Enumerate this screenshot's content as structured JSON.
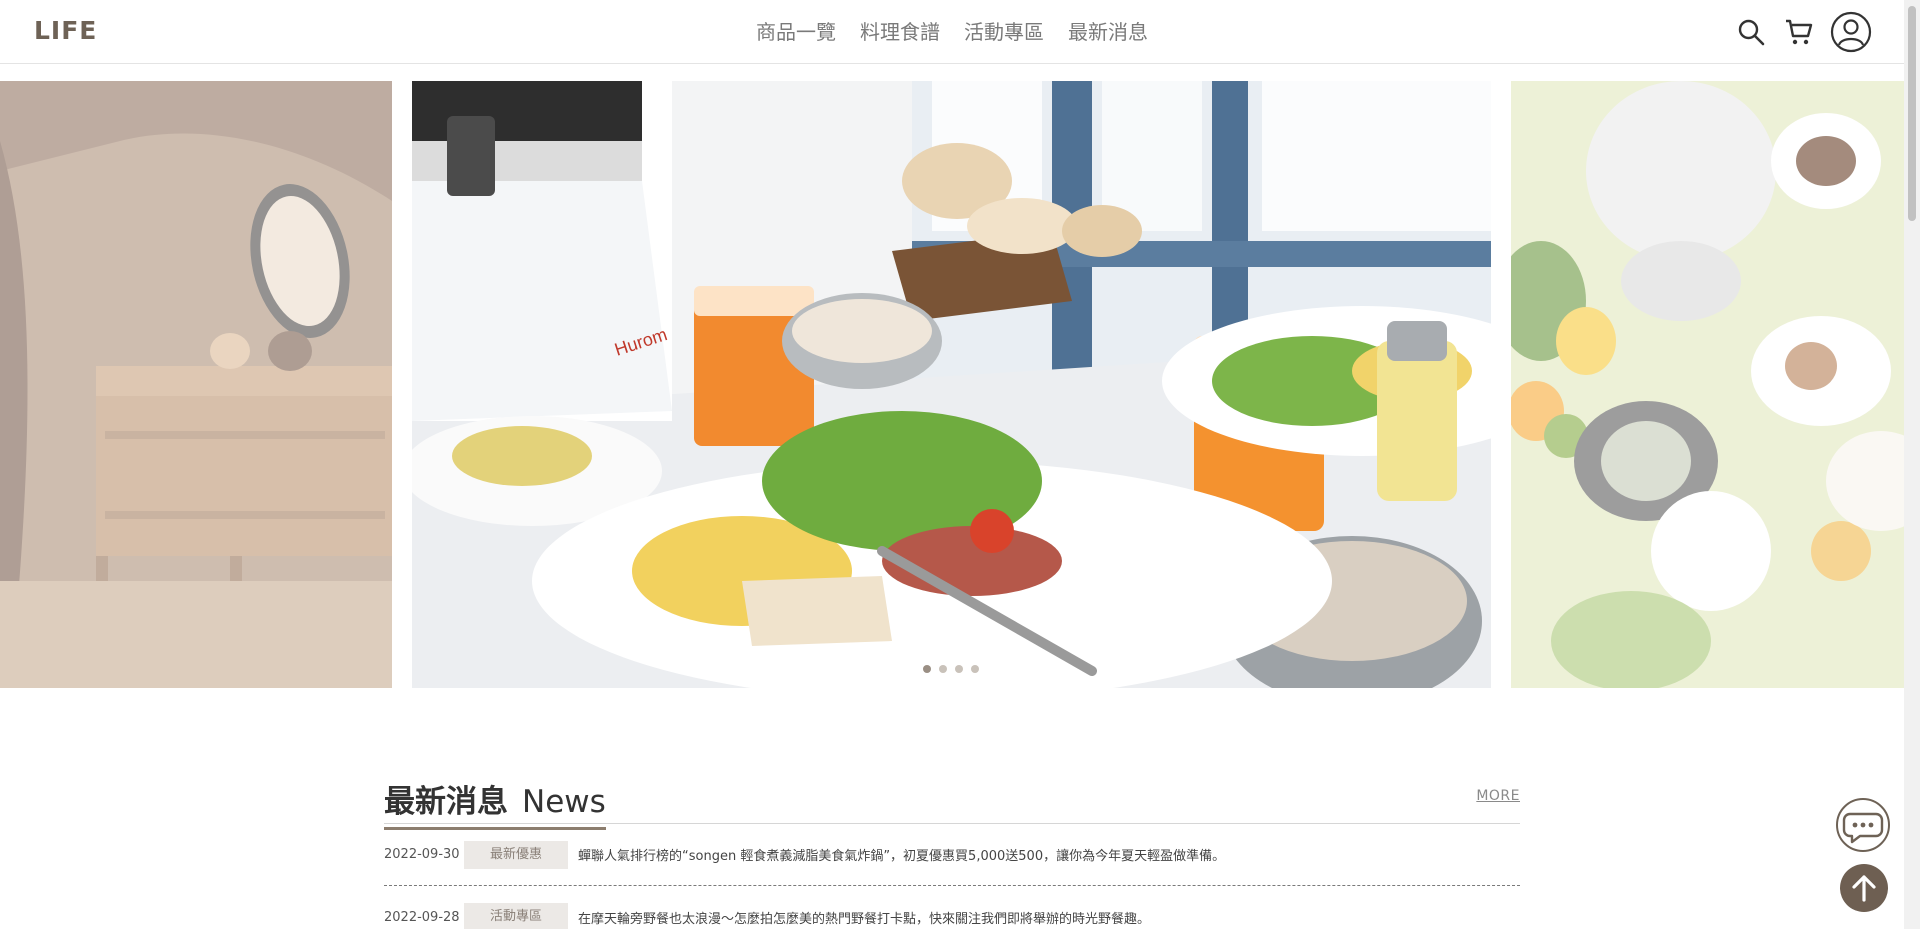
{
  "brand": {
    "logo": "LIFE"
  },
  "nav": {
    "items": [
      {
        "label": "商品一覽"
      },
      {
        "label": "料理食譜"
      },
      {
        "label": "活動專區"
      },
      {
        "label": "最新消息"
      }
    ]
  },
  "header_icons": [
    "search-icon",
    "cart-icon",
    "user-icon"
  ],
  "carousel": {
    "slides": [
      {
        "name": "tent-interior-with-tea-set"
      },
      {
        "name": "breakfast-table-with-hurom-juicer",
        "brand_text": "Hurom"
      },
      {
        "name": "kitchen-appliances-with-fruit"
      }
    ],
    "dot_count": 4,
    "active_index": 0
  },
  "news": {
    "title_zh": "最新消息",
    "title_en": "News",
    "more_label": "MORE",
    "items": [
      {
        "date": "2022-09-30",
        "tag": "最新優惠",
        "text": "蟬聯人氣排行榜的“songen 輕食煮義減脂美食氣炸鍋”，初夏優惠買5,000送500，讓你為今年夏天輕盈做準備。"
      },
      {
        "date": "2022-09-28",
        "tag": "活動專區",
        "text": "在摩天輪旁野餐也太浪漫～怎麼拍怎麼美的熱門野餐打卡點，快來關注我們即將舉辦的時光野餐趣。"
      }
    ]
  },
  "floating": {
    "chat_icon": "chat-icon",
    "top_icon": "arrow-up-icon"
  },
  "colors": {
    "brand": "#6e6256",
    "nav_text": "#7a7a7a",
    "tag_bg": "#ece9e6",
    "fab_bg": "#6e5f52"
  }
}
